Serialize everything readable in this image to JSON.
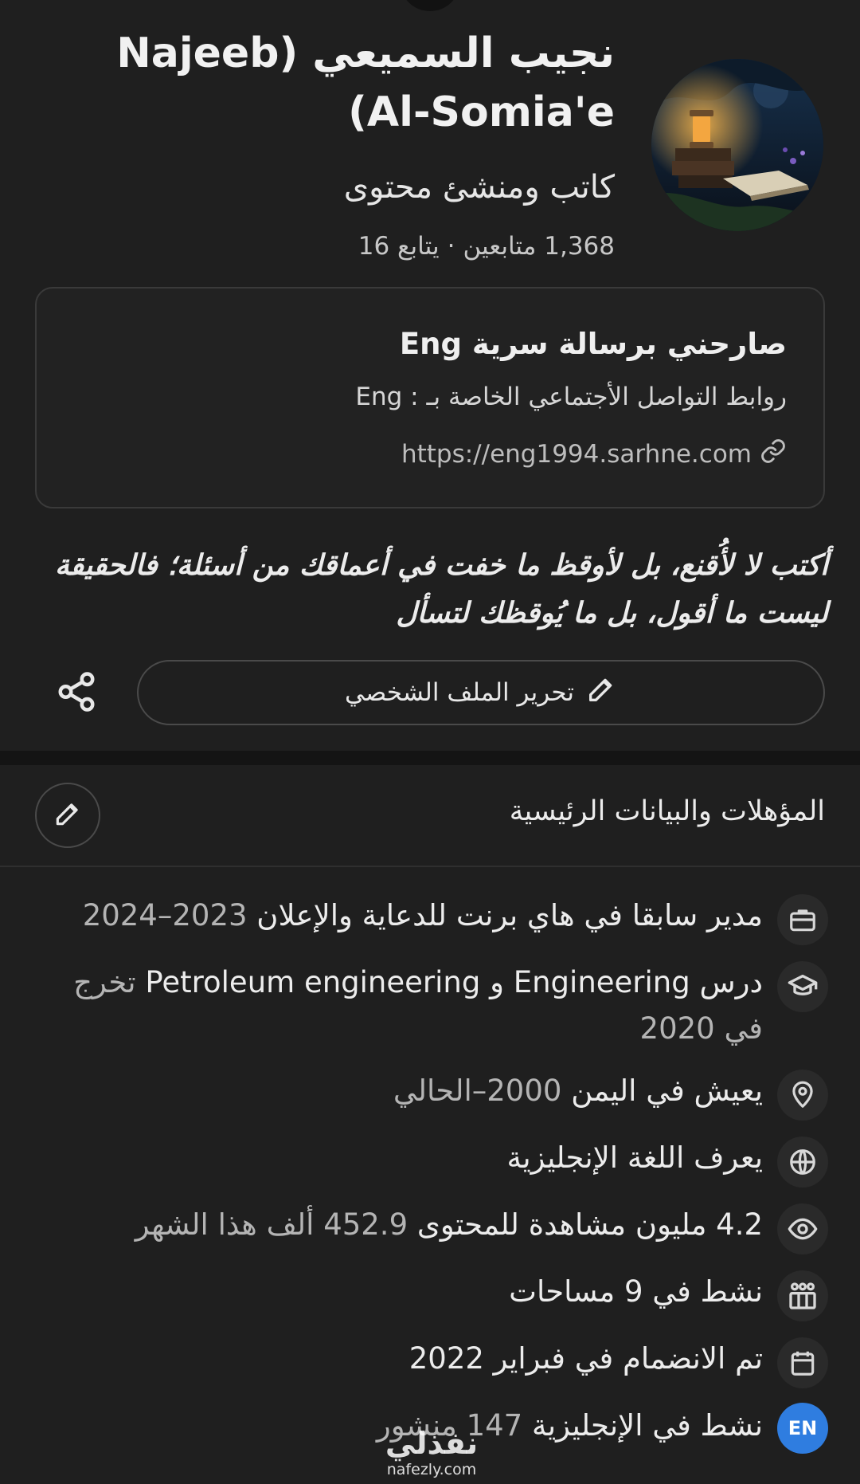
{
  "profile": {
    "name": "نجيب السميعي (Najeeb Al-Somia'e)",
    "headline": "كاتب ومنشئ محتوى",
    "followers_text": "1,368 متابعين",
    "following_text": "يتابع 16",
    "separator": "·"
  },
  "card": {
    "title": "صارحني برسالة سرية Eng",
    "description": "روابط التواصل الأجتماعي الخاصة بـ : Eng",
    "link": "https://eng1994.sarhne.com"
  },
  "bio": {
    "text": "أكتب لا لأُقنع، بل لأوقظ ما خفت في أعماقك من أسئلة؛ فالحقيقة ليست ما أقول، بل ما يُوقظك لتسأل"
  },
  "actions": {
    "edit_profile_label": "تحرير الملف الشخصي"
  },
  "section": {
    "title": "المؤهلات والبيانات الرئيسية"
  },
  "credentials": [
    {
      "icon": "briefcase-icon",
      "text": "مدير سابقا في هاي برنت للدعاية والإعلان",
      "muted": "2023–2024"
    },
    {
      "icon": "graduation-cap-icon",
      "text": "درس Engineering و Petroleum engineering",
      "muted": "تخرج في 2020"
    },
    {
      "icon": "location-pin-icon",
      "text": "يعيش في اليمن",
      "muted": "2000–الحالي"
    },
    {
      "icon": "globe-icon",
      "text": "يعرف اللغة الإنجليزية",
      "muted": ""
    },
    {
      "icon": "eye-icon",
      "text": "4.2 مليون مشاهدة للمحتوى",
      "muted": "452.9 ألف هذا الشهر"
    },
    {
      "icon": "spaces-icon",
      "text": "نشط في 9 مساحات",
      "muted": ""
    },
    {
      "icon": "calendar-icon",
      "text": "تم الانضمام في فبراير 2022",
      "muted": ""
    },
    {
      "icon": "en-badge",
      "badge": "EN",
      "text": "نشط في الإنجليزية",
      "muted": "147 منشور"
    }
  ],
  "watermark": {
    "main": "نفذلي",
    "sub": "nafezly.com"
  },
  "colors": {
    "background": "#1f1f1f",
    "en_badge": "#2f7de0",
    "text": "#ececec",
    "muted": "#b4b4b4"
  }
}
